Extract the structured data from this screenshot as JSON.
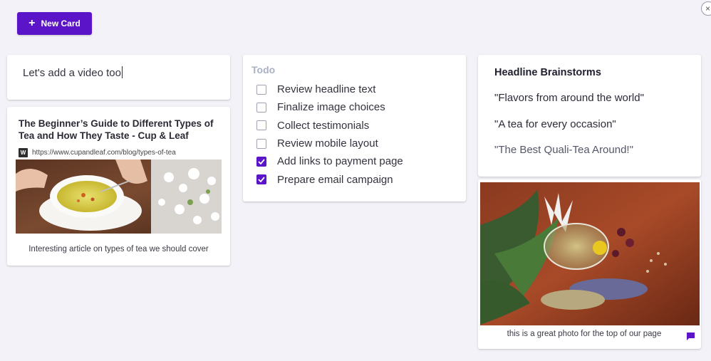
{
  "toolbar": {
    "new_card_label": "New Card",
    "plus_icon": "+"
  },
  "close": {
    "icon": "×"
  },
  "note_card": {
    "text": "Let's add a video too"
  },
  "link_card": {
    "title": "The Beginner’s Guide to Different Types of Tea and How They Taste - Cup & Leaf",
    "favicon": "W",
    "url": "https://www.cupandleaf.com/blog/types-of-tea",
    "caption": "Interesting article on types of tea we should cover"
  },
  "todo_card": {
    "heading": "Todo",
    "items": [
      {
        "label": "Review headline text",
        "checked": false
      },
      {
        "label": "Finalize image choices",
        "checked": false
      },
      {
        "label": "Collect testimonials",
        "checked": false
      },
      {
        "label": "Review mobile layout",
        "checked": false
      },
      {
        "label": "Add links to payment page",
        "checked": true
      },
      {
        "label": "Prepare email campaign",
        "checked": true
      }
    ]
  },
  "headline_card": {
    "title": "Headline Brainstorms",
    "lines": [
      "\"Flavors from around the world\"",
      "\"A tea for every occasion\"",
      "\"The Best Quali-Tea Around!\""
    ]
  },
  "photo_card": {
    "caption": "this is a great photo for the top of our page"
  },
  "colors": {
    "accent": "#5b14c8",
    "background": "#f2f2f8"
  }
}
